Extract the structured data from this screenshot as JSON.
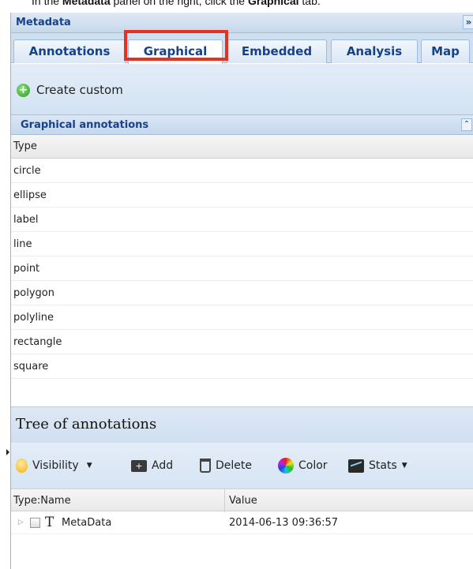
{
  "instruction": {
    "prefix": "In the",
    "panel_name": "Metadata",
    "middle": "panel on the right, click the",
    "tab_name": "Graphical",
    "suffix": "tab."
  },
  "panel": {
    "title": "Metadata",
    "collapse_glyph": "»"
  },
  "tabs": [
    {
      "label": "Annotations",
      "active": false
    },
    {
      "label": "Graphical",
      "active": true
    },
    {
      "label": "Embedded",
      "active": false
    },
    {
      "label": "Analysis",
      "active": false
    },
    {
      "label": "Map",
      "active": false
    }
  ],
  "toolbar": {
    "create_label": "Create custom"
  },
  "graphical_annotations": {
    "title": "Graphical annotations",
    "collapse_glyph": "⌃",
    "column_header": "Type",
    "rows": [
      "circle",
      "ellipse",
      "label",
      "line",
      "point",
      "polygon",
      "polyline",
      "rectangle",
      "square"
    ]
  },
  "tree": {
    "title": "Tree of annotations",
    "toolbar": {
      "visibility": "Visibility",
      "add": "Add",
      "delete": "Delete",
      "color": "Color",
      "stats": "Stats"
    },
    "columns": {
      "name": "Type:Name",
      "value": "Value"
    },
    "rows": [
      {
        "icon": "T",
        "name": "MetaData",
        "value": "2014-06-13 09:36:57"
      }
    ]
  },
  "colors": {
    "highlight": "#e8301e",
    "header_text": "#15428b"
  }
}
